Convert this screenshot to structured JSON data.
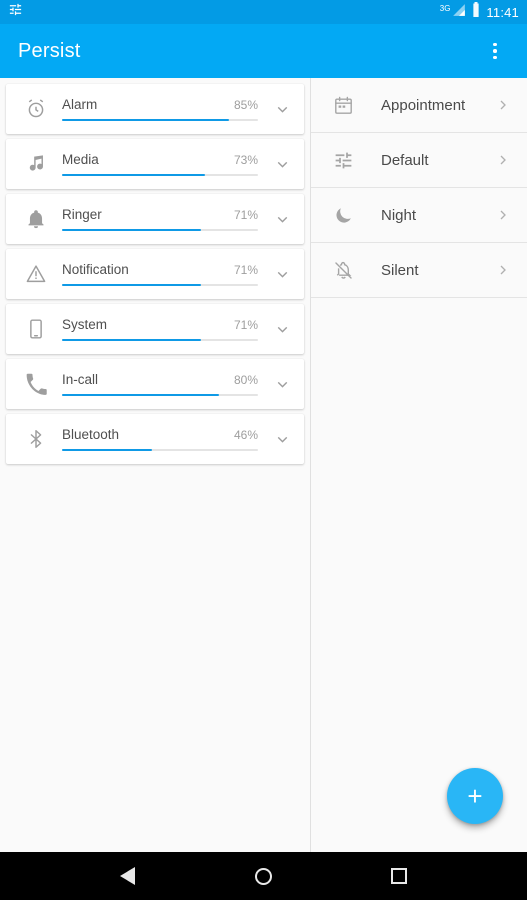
{
  "status_bar": {
    "icon_left": "equalizer-icon",
    "network": "3G",
    "signal_icon": "signal-bars-icon",
    "battery_icon": "battery-icon",
    "clock": "11:41"
  },
  "action_bar": {
    "title": "Persist",
    "overflow_label": "overflow-menu"
  },
  "volumes": [
    {
      "icon": "alarm-clock-icon",
      "label": "Alarm",
      "percent_label": "85%",
      "percent": 85
    },
    {
      "icon": "music-note-icon",
      "label": "Media",
      "percent_label": "73%",
      "percent": 73
    },
    {
      "icon": "bell-icon",
      "label": "Ringer",
      "percent_label": "71%",
      "percent": 71
    },
    {
      "icon": "warning-icon",
      "label": "Notification",
      "percent_label": "71%",
      "percent": 71
    },
    {
      "icon": "phone-tablet-icon",
      "label": "System",
      "percent_label": "71%",
      "percent": 71
    },
    {
      "icon": "phone-call-icon",
      "label": "In-call",
      "percent_label": "80%",
      "percent": 80
    },
    {
      "icon": "bluetooth-icon",
      "label": "Bluetooth",
      "percent_label": "46%",
      "percent": 46
    }
  ],
  "profiles": [
    {
      "icon": "calendar-icon",
      "label": "Appointment"
    },
    {
      "icon": "sliders-icon",
      "label": "Default"
    },
    {
      "icon": "moon-icon",
      "label": "Night"
    },
    {
      "icon": "bell-slash-icon",
      "label": "Silent"
    }
  ],
  "fab": {
    "label": "+",
    "name": "add-profile-button"
  },
  "nav_bar": {
    "back": "back-button",
    "home": "home-button",
    "recents": "recents-button"
  },
  "colors": {
    "status_bar": "#039be5",
    "action_bar": "#03a9f4",
    "accent": "#0f9ae6",
    "fab": "#29b6f6",
    "background": "#fafafa"
  }
}
